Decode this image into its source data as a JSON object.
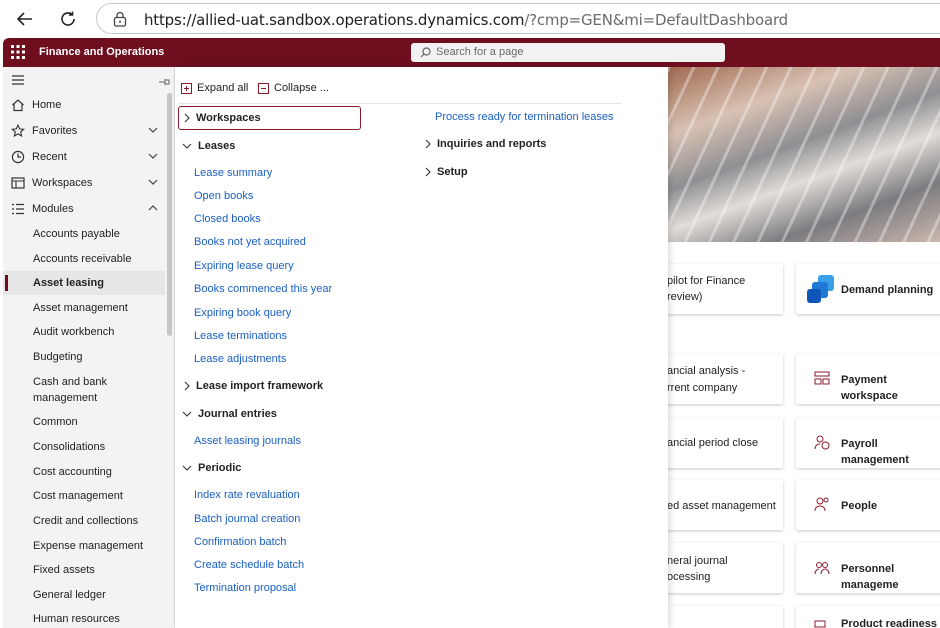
{
  "browser": {
    "url_host": "https://allied-uat.sandbox.operations.dynamics.com",
    "url_rest": "/?cmp=GEN&mi=DefaultDashboard"
  },
  "header": {
    "title": "Finance and Operations",
    "search_placeholder": "Search for a page",
    "accent_color": "#6e0e1f"
  },
  "nav": {
    "top_items": [
      {
        "label": "Home",
        "icon": "home-icon"
      },
      {
        "label": "Favorites",
        "icon": "star-icon"
      },
      {
        "label": "Recent",
        "icon": "clock-icon"
      },
      {
        "label": "Workspaces",
        "icon": "workspace-icon"
      },
      {
        "label": "Modules",
        "icon": "list-icon"
      }
    ],
    "modules": [
      "Accounts payable",
      "Accounts receivable",
      "Asset leasing",
      "Asset management",
      "Audit workbench",
      "Budgeting",
      "Cash and bank management",
      "Common",
      "Consolidations",
      "Cost accounting",
      "Cost management",
      "Credit and collections",
      "Expense management",
      "Fixed assets",
      "General ledger",
      "Human resources"
    ]
  },
  "flyout": {
    "expand_all": "Expand all",
    "collapse": "Collapse ...",
    "groups": {
      "workspaces": "Workspaces",
      "leases": "Leases",
      "lease_import": "Lease import framework",
      "journal_entries": "Journal entries",
      "periodic": "Periodic",
      "inquiries": "Inquiries and reports",
      "setup": "Setup"
    },
    "leases_links": [
      "Lease summary",
      "Open books",
      "Closed books",
      "Books not yet acquired",
      "Expiring lease query",
      "Books commenced this year",
      "Expiring book query",
      "Lease terminations",
      "Lease adjustments"
    ],
    "journal_links": [
      "Asset leasing journals"
    ],
    "periodic_links": [
      "Index rate revaluation",
      "Batch journal creation",
      "Confirmation batch",
      "Create schedule batch",
      "Termination proposal"
    ],
    "right_link": "Process ready for termination leases"
  },
  "dashboard": {
    "tiles_left": [
      {
        "line1": "pilot for Finance",
        "line2": "review)"
      },
      {
        "line1": "ancial analysis -",
        "line2": "rrent company"
      },
      {
        "line1": "ancial period close",
        "line2": ""
      },
      {
        "line1": "ed asset management",
        "line2": ""
      },
      {
        "line1": "neral journal",
        "line2": "ocessing"
      }
    ],
    "tiles_right": [
      {
        "label": "Demand planning",
        "icon": "demand-planning-icon"
      },
      {
        "label": "Payment workspace",
        "icon": "payment-icon"
      },
      {
        "label": "Payroll management",
        "icon": "payroll-icon"
      },
      {
        "label": "People",
        "icon": "people-icon"
      },
      {
        "label": "Personnel manageme",
        "icon": "personnel-icon"
      },
      {
        "label": "Product readiness fo",
        "icon": "product-icon"
      }
    ]
  }
}
